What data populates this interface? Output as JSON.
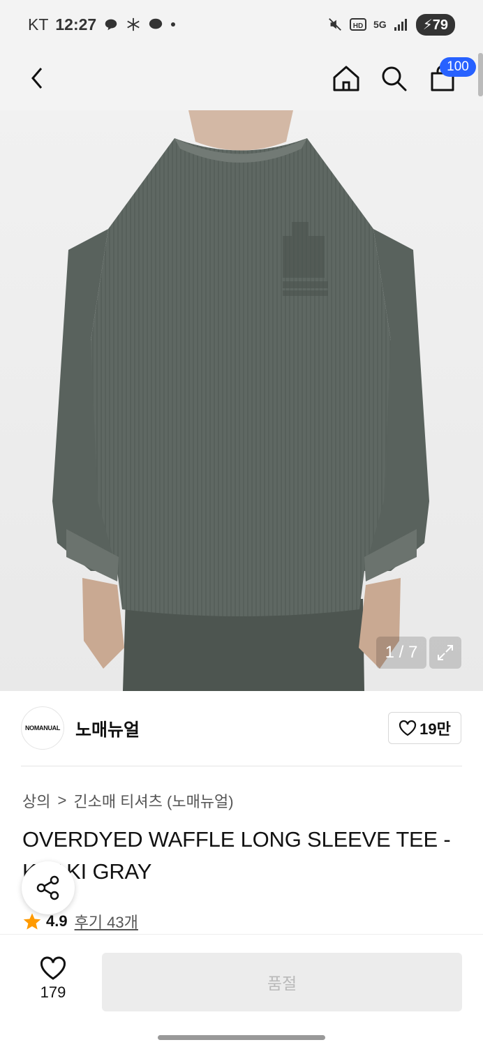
{
  "status_bar": {
    "carrier": "KT",
    "time": "12:27",
    "network": "5G",
    "battery": "79"
  },
  "nav": {
    "cart_badge": "100"
  },
  "gallery": {
    "counter": "1 / 7"
  },
  "brand": {
    "logo_text": "NOMANUAL",
    "name": "노매뉴얼",
    "like_count": "19만"
  },
  "breadcrumb": {
    "category": "상의",
    "separator": ">",
    "subcategory": "긴소매 티셔츠 (노매뉴얼)"
  },
  "product": {
    "title": "OVERDYED WAFFLE LONG SLEEVE TEE - KHAKI GRAY",
    "rating": "4.9",
    "reviews": "후기 43개"
  },
  "bottom_bar": {
    "like_count": "179",
    "soldout_label": "품절"
  },
  "colors": {
    "accent": "#2761ff",
    "star": "#ff9a00",
    "shirt": "#5f6863"
  },
  "icons": [
    "back-icon",
    "home-icon",
    "search-icon",
    "cart-icon",
    "expand-icon",
    "heart-icon",
    "share-icon",
    "star-icon"
  ]
}
